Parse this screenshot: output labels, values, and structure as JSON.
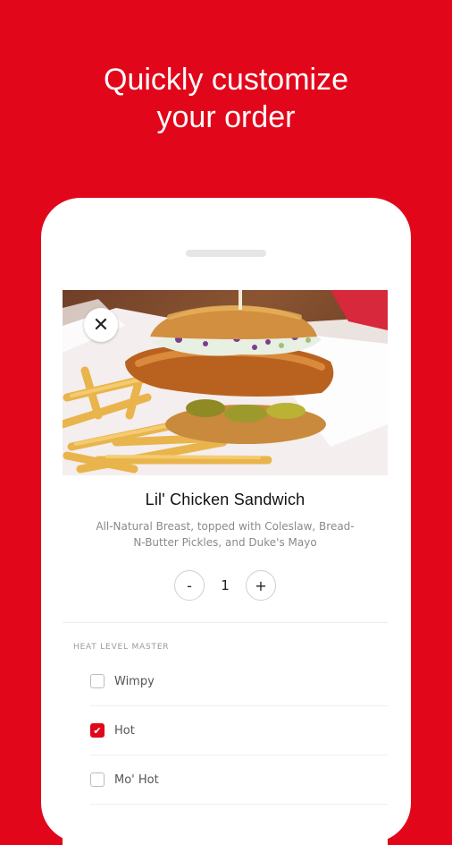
{
  "promo": {
    "headline_line1": "Quickly customize",
    "headline_line2": "your order"
  },
  "item": {
    "close_glyph": "✕",
    "title": "Lil' Chicken Sandwich",
    "description": "All-Natural Breast, topped with Coleslaw, Bread-N-Butter Pickles, and Duke's Mayo",
    "quantity": {
      "minus_label": "-",
      "value": "1",
      "plus_label": "+"
    }
  },
  "heat": {
    "section_label": "HEAT LEVEL MASTER",
    "options": [
      {
        "label": "Wimpy",
        "checked": false
      },
      {
        "label": "Hot",
        "checked": true
      },
      {
        "label": "Mo' Hot",
        "checked": false
      }
    ]
  },
  "colors": {
    "brand_red": "#e2061b"
  }
}
